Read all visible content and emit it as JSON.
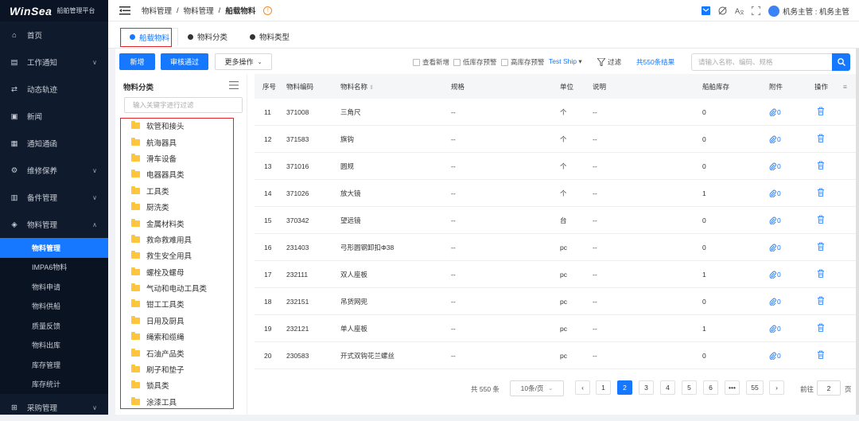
{
  "app": {
    "brand": "WinSea",
    "subtitle": "船舶管理平台"
  },
  "sidebar": {
    "items": [
      {
        "label": "首页",
        "icon": "home-icon",
        "chevron": false
      },
      {
        "label": "工作通知",
        "icon": "notice-icon",
        "chevron": true
      },
      {
        "label": "动态轨迹",
        "icon": "track-icon",
        "chevron": false
      },
      {
        "label": "新闻",
        "icon": "news-icon",
        "chevron": false
      },
      {
        "label": "通知通函",
        "icon": "circular-icon",
        "chevron": false
      },
      {
        "label": "维修保养",
        "icon": "maintenance-icon",
        "chevron": true
      },
      {
        "label": "备件管理",
        "icon": "spare-parts-icon",
        "chevron": true
      },
      {
        "label": "物料管理",
        "icon": "materials-icon",
        "chevron": true,
        "expanded": true
      }
    ],
    "submenu": [
      "物料管理",
      "IMPA6物料",
      "物料申请",
      "物料供船",
      "质量反馈",
      "物料出库",
      "库存管理",
      "库存统计"
    ],
    "submenu_active": "物料管理",
    "bottom_item": {
      "label": "采购管理",
      "icon": "purchase-icon"
    }
  },
  "breadcrumb": [
    "物料管理",
    "物料管理",
    "船载物料"
  ],
  "topbar": {
    "user": "机务主管 : 机务主管"
  },
  "tabs": [
    "船载物料",
    "物料分类",
    "物料类型"
  ],
  "toolbar": {
    "add": "新增",
    "approve": "审核通过",
    "more": "更多操作",
    "checks": [
      "查看新增",
      "低库存预警",
      "高库存预警"
    ],
    "ship": "Test Ship",
    "filter": "过滤",
    "total_link": "共550条结果",
    "search_placeholder": "请输入名称、编码、规格"
  },
  "category": {
    "title": "物料分类",
    "filter_placeholder": "输入关键字进行过滤",
    "items": [
      "软管和接头",
      "航海器具",
      "滑车设备",
      "电器器具类",
      "工具类",
      "厨洗类",
      "金属材料类",
      "救命救难用具",
      "救生安全用具",
      "螺栓及螺母",
      "气动和电动工具类",
      "钳工工具类",
      "日用及厨具",
      "绳索和缆绳",
      "石油产品类",
      "刷子和垫子",
      "锁具类",
      "涂漆工具"
    ]
  },
  "table": {
    "headers": {
      "seq": "序号",
      "code": "物料编码",
      "name": "物料名称",
      "spec": "规格",
      "unit": "单位",
      "desc": "说明",
      "stock": "船舶库存",
      "attach": "附件",
      "ops": "操作"
    },
    "rows": [
      {
        "seq": "11",
        "code": "371008",
        "name": "三角尺",
        "spec": "--",
        "unit": "个",
        "desc": "--",
        "stock": "0",
        "attach": "0"
      },
      {
        "seq": "12",
        "code": "371583",
        "name": "旗钩",
        "spec": "--",
        "unit": "个",
        "desc": "--",
        "stock": "0",
        "attach": "0"
      },
      {
        "seq": "13",
        "code": "371016",
        "name": "圆规",
        "spec": "--",
        "unit": "个",
        "desc": "--",
        "stock": "0",
        "attach": "0"
      },
      {
        "seq": "14",
        "code": "371026",
        "name": "放大镜",
        "spec": "--",
        "unit": "个",
        "desc": "--",
        "stock": "1",
        "attach": "0"
      },
      {
        "seq": "15",
        "code": "370342",
        "name": "望远镜",
        "spec": "--",
        "unit": "台",
        "desc": "--",
        "stock": "0",
        "attach": "0"
      },
      {
        "seq": "16",
        "code": "231403",
        "name": "弓形圆钢卸扣Φ38",
        "spec": "--",
        "unit": "pc",
        "desc": "--",
        "stock": "0",
        "attach": "0"
      },
      {
        "seq": "17",
        "code": "232111",
        "name": "双人座板",
        "spec": "--",
        "unit": "pc",
        "desc": "--",
        "stock": "1",
        "attach": "0"
      },
      {
        "seq": "18",
        "code": "232151",
        "name": "吊货网兜",
        "spec": "--",
        "unit": "pc",
        "desc": "--",
        "stock": "0",
        "attach": "0"
      },
      {
        "seq": "19",
        "code": "232121",
        "name": "单人座板",
        "spec": "--",
        "unit": "pc",
        "desc": "--",
        "stock": "1",
        "attach": "0"
      },
      {
        "seq": "20",
        "code": "230583",
        "name": "开式双钩花兰螺丝",
        "spec": "--",
        "unit": "pc",
        "desc": "--",
        "stock": "0",
        "attach": "0"
      }
    ]
  },
  "pager": {
    "total": "共 550 条",
    "page_size": "10条/页",
    "pages": [
      "1",
      "2",
      "3",
      "4",
      "5",
      "6",
      "•••",
      "55"
    ],
    "current": "2",
    "goto_label": "前往",
    "goto_value": "2",
    "page_suffix": "页"
  },
  "colors": {
    "accent": "#1677ff",
    "sidebar": "#0f1a2c",
    "highlight_box": "#e0242a"
  }
}
